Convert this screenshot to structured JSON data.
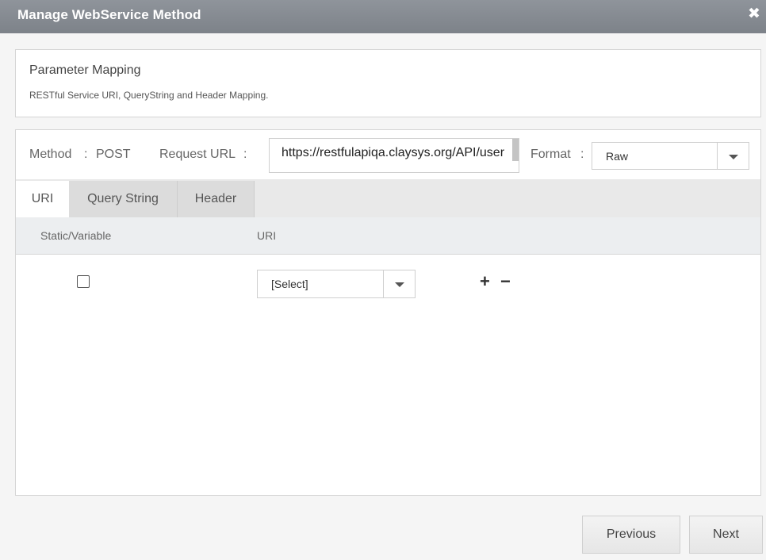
{
  "dialog": {
    "title": "Manage WebService Method",
    "close_icon": "close-icon"
  },
  "info": {
    "heading": "Parameter Mapping",
    "description": "RESTful Service URI, QueryString and Header Mapping."
  },
  "form": {
    "method_label": "Method",
    "method_sep": ":",
    "method_value": "POST",
    "request_url_label": "Request URL",
    "request_url_sep": ":",
    "request_url_value": "https://restfulapiqa.claysys.org/API/user",
    "format_label": "Format",
    "format_sep": ":",
    "format_value": "Raw"
  },
  "tabs": [
    {
      "label": "URI",
      "active": true
    },
    {
      "label": "Query String",
      "active": false
    },
    {
      "label": "Header",
      "active": false
    }
  ],
  "grid": {
    "columns": [
      "Static/Variable",
      "URI"
    ],
    "rows": [
      {
        "checked": false,
        "select_value": "[Select]",
        "add_icon": "+",
        "remove_icon": "−"
      }
    ]
  },
  "footer": {
    "previous_label": "Previous",
    "next_label": "Next"
  }
}
